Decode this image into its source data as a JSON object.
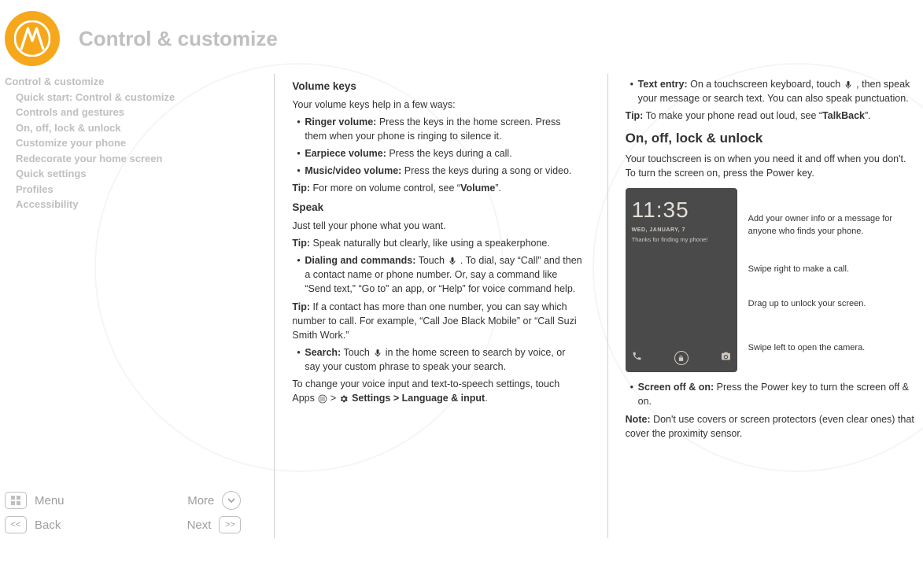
{
  "header": {
    "title": "Control & customize"
  },
  "toc": {
    "items": [
      {
        "label": "Control & customize",
        "indent": false
      },
      {
        "label": "Quick start: Control & customize",
        "indent": true
      },
      {
        "label": "Controls and gestures",
        "indent": true
      },
      {
        "label": "On, off, lock & unlock",
        "indent": true
      },
      {
        "label": "Customize your phone",
        "indent": true
      },
      {
        "label": "Redecorate your home screen",
        "indent": true
      },
      {
        "label": "Quick settings",
        "indent": true
      },
      {
        "label": "Profiles",
        "indent": true
      },
      {
        "label": "Accessibility",
        "indent": true
      }
    ]
  },
  "nav": {
    "menu": "Menu",
    "more": "More",
    "back": "Back",
    "next": "Next"
  },
  "col1": {
    "h_volume": "Volume keys",
    "p_volume_intro": "Your volume keys help in a few ways:",
    "b_ringer_bold": "Ringer volume:",
    "b_ringer_rest": " Press the keys in the home screen. Press them when your phone is ringing to silence it.",
    "b_earpiece_bold": "Earpiece volume:",
    "b_earpiece_rest": " Press the keys during a call.",
    "b_music_bold": "Music/video volume:",
    "b_music_rest": " Press the keys during a song or video.",
    "tip_volume_pre": "Tip:",
    "tip_volume_mid": " For more on volume control, see “",
    "tip_volume_bold": "Volume",
    "tip_volume_post": "”.",
    "h_speak": "Speak",
    "p_speak_intro": "Just tell your phone what you want.",
    "tip_speak_pre": "Tip:",
    "tip_speak_rest": " Speak naturally but clearly, like using a speakerphone.",
    "b_dial_bold": "Dialing and commands:",
    "b_dial_rest_a": " Touch ",
    "b_dial_rest_b": ". To dial, say “Call” and then a contact name or phone number. Or, say a command like “Send text,” “Go to” an app, or “Help” for voice command help.",
    "tip_dial_pre": "Tip:",
    "tip_dial_rest": " If a contact has more than one number, you can say which number to call. For example, “Call Joe Black Mobile” or “Call Suzi Smith Work.”",
    "b_search_bold": "Search:",
    "b_search_rest_a": " Touch ",
    "b_search_rest_b": " in the home screen to search by voice, or say your custom phrase to speak your search.",
    "p_change_a": "To change your voice input and text-to-speech settings, touch Apps ",
    "p_change_arrow": " > ",
    "p_change_settings": " Settings",
    "p_change_lang": " > Language & input",
    "p_change_end": "."
  },
  "col2": {
    "b_text_bold": "Text entry:",
    "b_text_rest_a": " On a touchscreen keyboard, touch ",
    "b_text_rest_b": ", then speak your message or search text. You can also speak punctuation.",
    "tip_read_pre": "Tip:",
    "tip_read_mid": " To make your phone read out loud, see “",
    "tip_read_bold": "TalkBack",
    "tip_read_post": "”.",
    "h_onoff": "On, off, lock & unlock",
    "p_onoff": "Your touchscreen is on when you need it and off when you don't. To turn the screen on, press the Power key.",
    "phone": {
      "time": "11:35",
      "date": "WED, JANUARY, 7",
      "msg": "Thanks for finding my phone!"
    },
    "callouts": {
      "c1": "Add your owner info or a message for anyone who finds your phone.",
      "c2": "Swipe right to make a call.",
      "c3": "Drag up to unlock your screen.",
      "c4": "Swipe left to open the camera."
    },
    "b_screen_bold": "Screen off & on:",
    "b_screen_rest": " Press the Power key to turn the screen off & on.",
    "note_pre": "Note:",
    "note_rest": " Don't use covers or screen protectors (even clear ones) that cover the proximity sensor."
  }
}
